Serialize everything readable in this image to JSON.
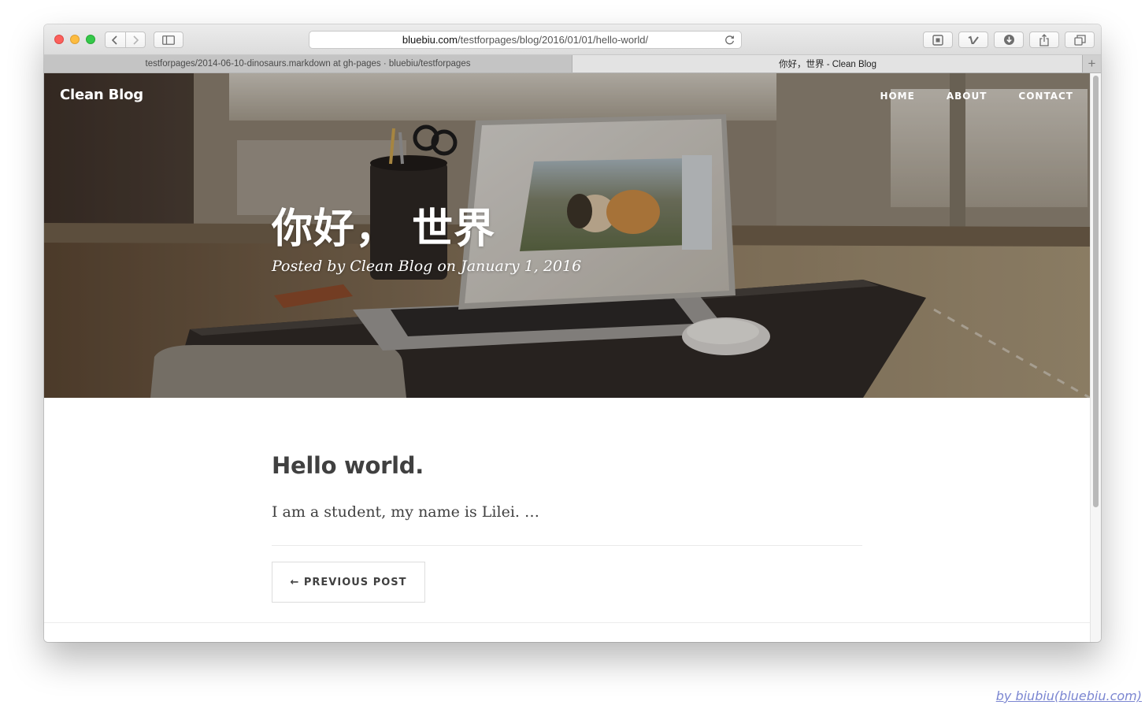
{
  "browser": {
    "address": {
      "host": "bluebiu.com",
      "path": "/testforpages/blog/2016/01/01/hello-world/"
    },
    "tabs": [
      {
        "label": "testforpages/2014-06-10-dinosaurs.markdown at gh-pages · bluebiu/testforpages",
        "active": false
      },
      {
        "label": "你好，世界 - Clean Blog",
        "active": true
      }
    ],
    "new_tab_label": "+"
  },
  "site": {
    "brand": "Clean Blog",
    "nav": [
      {
        "label": "HOME"
      },
      {
        "label": "ABOUT"
      },
      {
        "label": "CONTACT"
      }
    ]
  },
  "post": {
    "title": "你好， 世界",
    "meta": "Posted by Clean Blog on January 1, 2016",
    "heading": "Hello world.",
    "body": "I am a student, my name is Lilei. …",
    "previous_label": "← PREVIOUS POST"
  },
  "credit": "by biubiu(bluebiu.com)",
  "colors": {
    "text": "#404040",
    "link_credit": "#7b86d1",
    "close": "#fc605c",
    "minimize": "#fdbc40",
    "maximize": "#34c84a"
  },
  "icons": {
    "back": "chevron-left-icon",
    "forward": "chevron-right-icon",
    "sidebar": "sidebar-icon",
    "reload": "reload-icon",
    "reader": "reader-icon",
    "extension": "vimeo-icon",
    "download": "download-icon",
    "share": "share-icon",
    "tabs": "tabs-icon"
  }
}
